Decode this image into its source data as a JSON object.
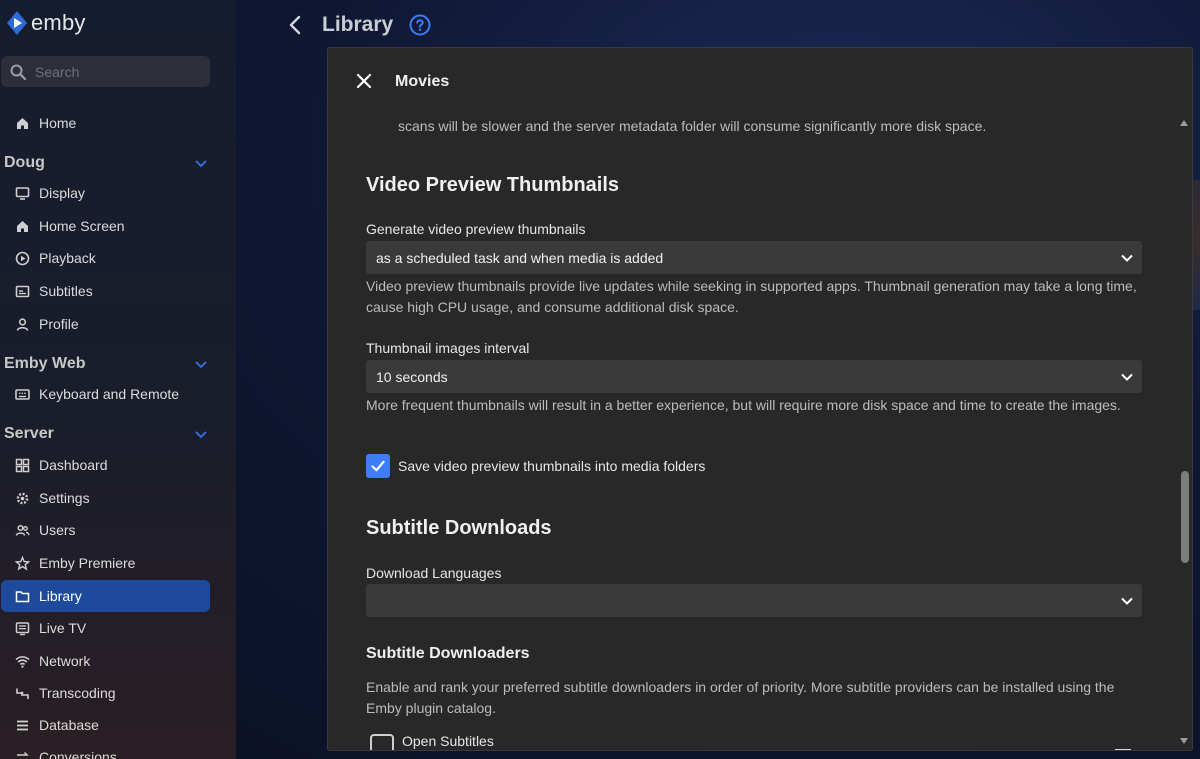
{
  "app": {
    "logo_text": "emby"
  },
  "search": {
    "placeholder": "Search"
  },
  "sidebar": {
    "home": "Home",
    "sections": [
      {
        "title": "Doug",
        "items": [
          "Display",
          "Home Screen",
          "Playback",
          "Subtitles",
          "Profile"
        ]
      },
      {
        "title": "Emby Web",
        "items": [
          "Keyboard and Remote"
        ]
      },
      {
        "title": "Server",
        "items": [
          "Dashboard",
          "Settings",
          "Users",
          "Emby Premiere",
          "Library",
          "Live TV",
          "Network",
          "Transcoding",
          "Database",
          "Conversions"
        ]
      }
    ],
    "active_item": "Library"
  },
  "header": {
    "title": "Library"
  },
  "dialog": {
    "title": "Movies",
    "intro_text": "scans will be slower and the server metadata folder will consume significantly more disk space.",
    "video_preview": {
      "heading": "Video Preview Thumbnails",
      "generate_label": "Generate video preview thumbnails",
      "generate_value": "as a scheduled task and when media is added",
      "generate_help": "Video preview thumbnails provide live updates while seeking in supported apps. Thumbnail generation may take a long time, cause high CPU usage, and consume additional disk space.",
      "interval_label": "Thumbnail images interval",
      "interval_value": "10 seconds",
      "interval_help": "More frequent thumbnails will result in a better experience, but will require more disk space and time to create the images.",
      "save_checkbox_label": "Save video preview thumbnails into media folders",
      "save_checkbox_checked": true
    },
    "subtitle_downloads": {
      "heading": "Subtitle Downloads",
      "languages_label": "Download Languages",
      "languages_value": "",
      "downloaders_heading": "Subtitle Downloaders",
      "downloaders_help": "Enable and rank your preferred subtitle downloaders in order of priority. More subtitle providers can be installed using the Emby plugin catalog.",
      "downloaders": [
        {
          "label": "Open Subtitles",
          "checked": false
        }
      ]
    }
  },
  "colors": {
    "accent": "#3d7ef6",
    "active_nav": "#1e4a9c",
    "dialog_bg": "#282828",
    "field_bg": "#3a3a3a"
  }
}
